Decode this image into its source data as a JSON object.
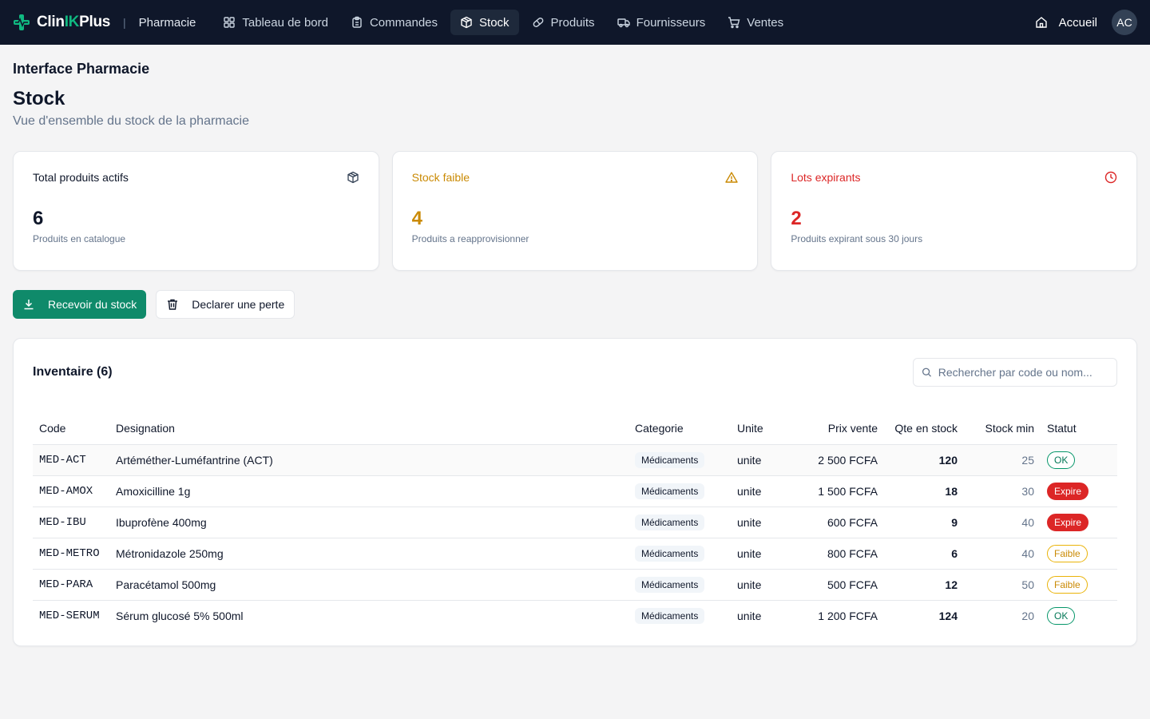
{
  "brand": {
    "name_prefix": "Clin",
    "name_highlight": "IK",
    "name_suffix": "Plus",
    "module": "Pharmacie",
    "separator": "|"
  },
  "nav": [
    {
      "label": "Tableau de bord",
      "icon": "grid-icon",
      "active": false
    },
    {
      "label": "Commandes",
      "icon": "clipboard-icon",
      "active": false
    },
    {
      "label": "Stock",
      "icon": "package-icon",
      "active": true
    },
    {
      "label": "Produits",
      "icon": "pill-icon",
      "active": false
    },
    {
      "label": "Fournisseurs",
      "icon": "truck-icon",
      "active": false
    },
    {
      "label": "Ventes",
      "icon": "cart-icon",
      "active": false
    }
  ],
  "header": {
    "home_label": "Accueil",
    "avatar_initials": "AC"
  },
  "page": {
    "section_title": "Interface Pharmacie",
    "title": "Stock",
    "subtitle": "Vue d'ensemble du stock de la pharmacie"
  },
  "cards": [
    {
      "title": "Total produits actifs",
      "value": "6",
      "desc": "Produits en catalogue",
      "icon": "package-icon",
      "tone": "normal"
    },
    {
      "title": "Stock faible",
      "value": "4",
      "desc": "Produits a reapprovisionner",
      "icon": "warning-icon",
      "tone": "warn"
    },
    {
      "title": "Lots expirants",
      "value": "2",
      "desc": "Produits expirant sous 30 jours",
      "icon": "clock-icon",
      "tone": "danger"
    }
  ],
  "actions": {
    "receive_label": "Recevoir du stock",
    "loss_label": "Declarer une perte"
  },
  "inventory": {
    "title": "Inventaire (6)",
    "search_placeholder": "Rechercher par code ou nom...",
    "columns": [
      "Code",
      "Designation",
      "Categorie",
      "Unite",
      "Prix vente",
      "Qte en stock",
      "Stock min",
      "Statut"
    ],
    "rows": [
      {
        "code": "MED-ACT",
        "designation": "Artéméther-Luméfantrine (ACT)",
        "categorie": "Médicaments",
        "unite": "unite",
        "prix": "2 500 FCFA",
        "qte": "120",
        "min": "25",
        "statut": "OK",
        "status_type": "ok"
      },
      {
        "code": "MED-AMOX",
        "designation": "Amoxicilline 1g",
        "categorie": "Médicaments",
        "unite": "unite",
        "prix": "1 500 FCFA",
        "qte": "18",
        "min": "30",
        "statut": "Expire",
        "status_type": "expire"
      },
      {
        "code": "MED-IBU",
        "designation": "Ibuprofène 400mg",
        "categorie": "Médicaments",
        "unite": "unite",
        "prix": "600 FCFA",
        "qte": "9",
        "min": "40",
        "statut": "Expire",
        "status_type": "expire"
      },
      {
        "code": "MED-METRO",
        "designation": "Métronidazole 250mg",
        "categorie": "Médicaments",
        "unite": "unite",
        "prix": "800 FCFA",
        "qte": "6",
        "min": "40",
        "statut": "Faible",
        "status_type": "faible"
      },
      {
        "code": "MED-PARA",
        "designation": "Paracétamol 500mg",
        "categorie": "Médicaments",
        "unite": "unite",
        "prix": "500 FCFA",
        "qte": "12",
        "min": "50",
        "statut": "Faible",
        "status_type": "faible"
      },
      {
        "code": "MED-SERUM",
        "designation": "Sérum glucosé 5% 500ml",
        "categorie": "Médicaments",
        "unite": "unite",
        "prix": "1 200 FCFA",
        "qte": "124",
        "min": "20",
        "statut": "OK",
        "status_type": "ok"
      }
    ]
  },
  "colors": {
    "nav_bg": "#0f172a",
    "accent": "#0f8a6a",
    "brand_green": "#10b981",
    "warn": "#ca8a04",
    "danger": "#dc2626"
  }
}
